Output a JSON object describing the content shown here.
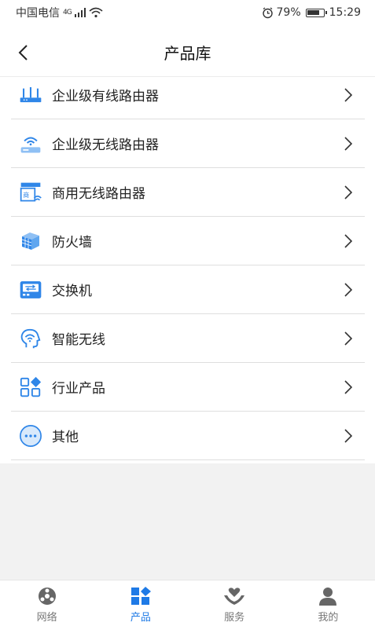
{
  "status": {
    "carrier": "中国电信",
    "network": "4G",
    "battery": "79%",
    "time": "15:29"
  },
  "header": {
    "title": "产品库"
  },
  "items": [
    {
      "label": "企业级有线路由器",
      "icon": "wired-router-icon"
    },
    {
      "label": "企业级无线路由器",
      "icon": "wireless-router-icon"
    },
    {
      "label": "商用无线路由器",
      "icon": "commercial-router-icon"
    },
    {
      "label": "防火墙",
      "icon": "firewall-icon"
    },
    {
      "label": "交换机",
      "icon": "switch-icon"
    },
    {
      "label": "智能无线",
      "icon": "smart-wireless-icon"
    },
    {
      "label": "行业产品",
      "icon": "industry-products-icon"
    },
    {
      "label": "其他",
      "icon": "more-icon"
    }
  ],
  "tabs": [
    {
      "label": "网络",
      "icon": "network-icon",
      "active": false
    },
    {
      "label": "产品",
      "icon": "products-icon",
      "active": true
    },
    {
      "label": "服务",
      "icon": "service-icon",
      "active": false
    },
    {
      "label": "我的",
      "icon": "profile-icon",
      "active": false
    }
  ],
  "colors": {
    "accent": "#1e7ae6",
    "icon_blue": "#2f86e8",
    "tab_inactive": "#666666"
  }
}
